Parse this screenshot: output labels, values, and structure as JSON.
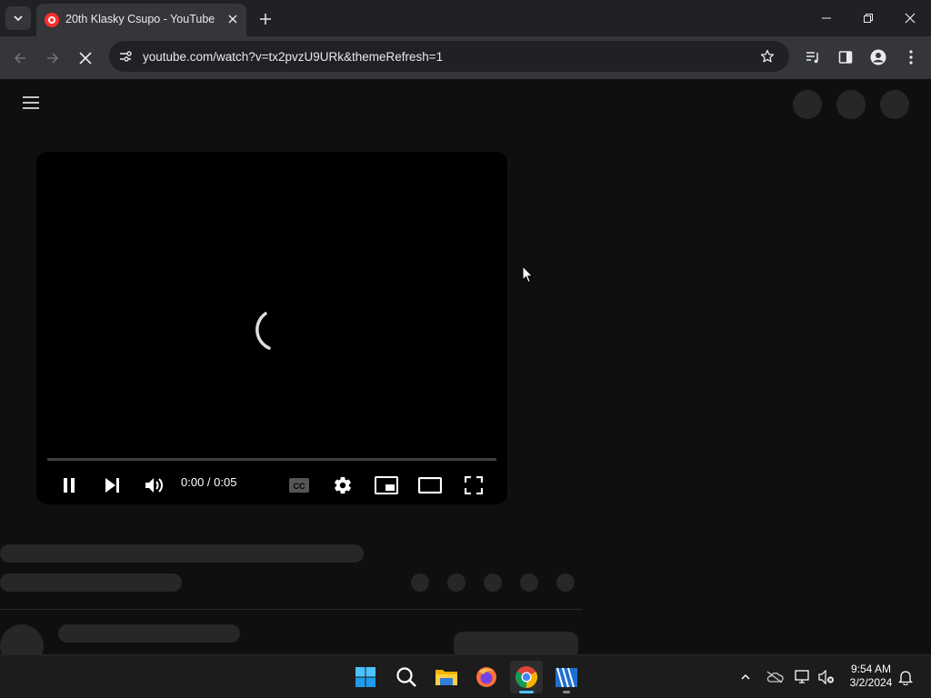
{
  "browser": {
    "tab": {
      "title": "20th Klasky Csupo - YouTube"
    },
    "omnibox": {
      "url": "youtube.com/watch?v=tx2pvzU9URk&themeRefresh=1"
    }
  },
  "player": {
    "time_display": "0:00 / 0:05",
    "progress": 0,
    "state": "loading"
  },
  "taskbar": {
    "apps": [
      {
        "name": "start",
        "icon": "windows-logo-icon"
      },
      {
        "name": "search",
        "icon": "search-icon"
      },
      {
        "name": "file-explorer",
        "icon": "folder-icon"
      },
      {
        "name": "firefox",
        "icon": "firefox-icon"
      },
      {
        "name": "chrome",
        "icon": "chrome-icon",
        "active": true
      },
      {
        "name": "movie-editor",
        "icon": "clapperboard-icon"
      }
    ],
    "clock": {
      "time": "9:54 AM",
      "date": "3/2/2024"
    }
  },
  "colors": {
    "page_bg": "#0f0f0f",
    "skeleton": "#272727",
    "chrome_frame": "#202124",
    "chrome_toolbar": "#35363a",
    "youtube_red": "#ff0000"
  }
}
